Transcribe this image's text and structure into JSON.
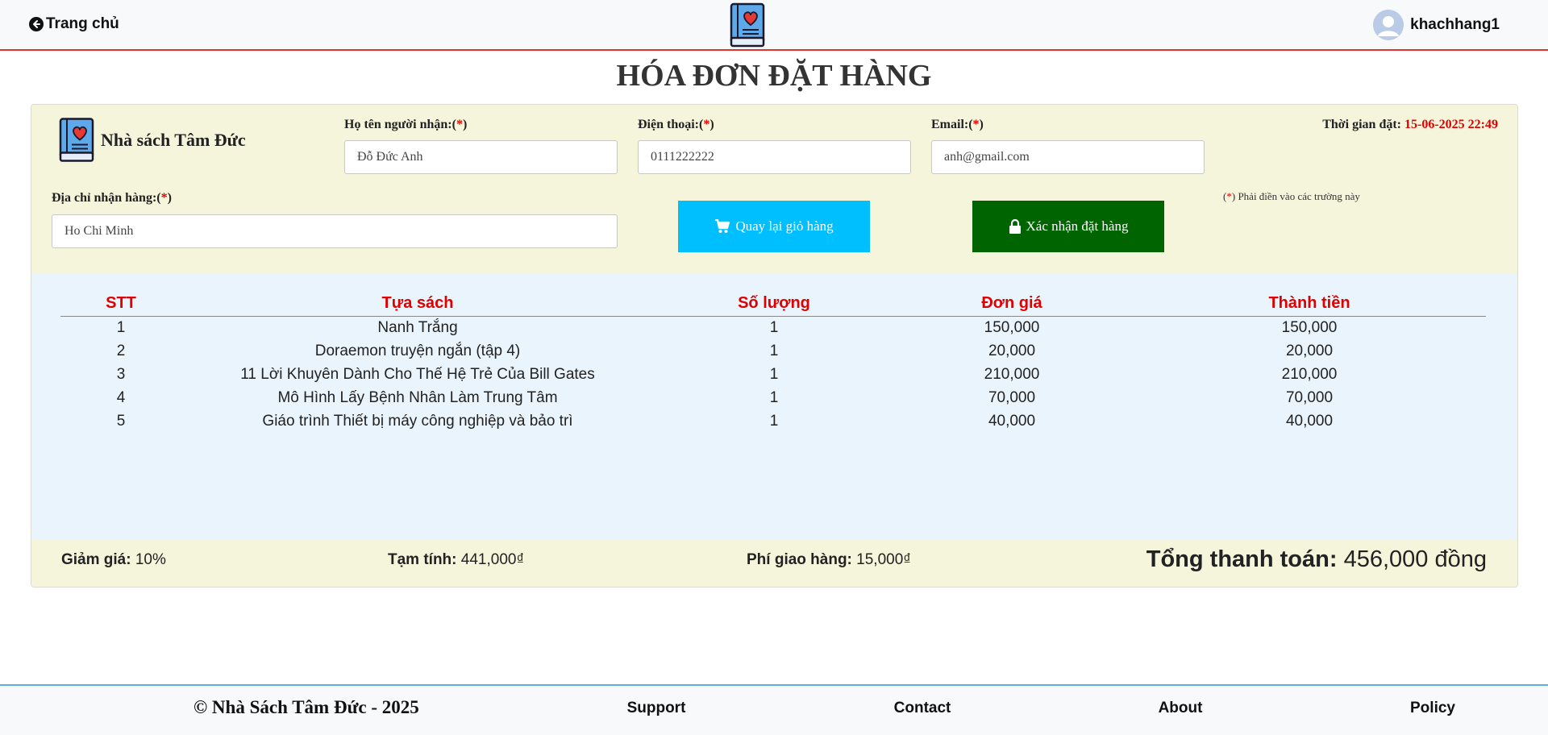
{
  "header": {
    "home_label": "Trang chủ",
    "username": "khachhang1",
    "logo_icon": "book-heart-icon"
  },
  "page_title": "HÓA ĐƠN ĐẶT HÀNG",
  "shop": {
    "name": "Nhà sách Tâm Đức"
  },
  "form": {
    "required_mark": "*",
    "name_label": "Họ tên người nhận:",
    "name_value": "Đỗ Đức Anh",
    "phone_label": "Điện thoại:",
    "phone_value": "0111222222",
    "email_label": "Email:",
    "email_value": "anh@gmail.com",
    "address_label": "Địa chỉ nhận hàng:",
    "address_value": "Ho Chi Minh",
    "order_time_label": "Thời gian đặt:",
    "order_time_value": "15-06-2025 22:49",
    "note_text": "Phải điền vào các trường này"
  },
  "buttons": {
    "back_label": "Quay lại giỏ hàng",
    "confirm_label": "Xác nhận đặt hàng"
  },
  "table": {
    "headers": [
      "STT",
      "Tựa sách",
      "Số lượng",
      "Đơn giá",
      "Thành tiền"
    ],
    "rows": [
      [
        "1",
        "Nanh Trắng",
        "1",
        "150,000",
        "150,000"
      ],
      [
        "2",
        "Doraemon truyện ngắn (tập 4)",
        "1",
        "20,000",
        "20,000"
      ],
      [
        "3",
        "11 Lời Khuyên Dành Cho Thế Hệ Trẻ Của Bill Gates",
        "1",
        "210,000",
        "210,000"
      ],
      [
        "4",
        "Mô Hình Lấy Bệnh Nhân Làm Trung Tâm",
        "1",
        "70,000",
        "70,000"
      ],
      [
        "5",
        "Giáo trình Thiết bị máy công nghiệp và bảo trì",
        "1",
        "40,000",
        "40,000"
      ]
    ]
  },
  "summary": {
    "discount_label": "Giảm giá:",
    "discount_value": "10%",
    "subtotal_label": "Tạm tính:",
    "subtotal_value": "441,000₫",
    "shipping_label": "Phí giao hàng:",
    "shipping_value": "15,000₫",
    "total_label": "Tổng thanh toán:",
    "total_value": "456,000 đồng"
  },
  "footer": {
    "copyright": "© Nhà Sách Tâm Đức - 2025",
    "links": [
      "Support",
      "Contact",
      "About",
      "Policy"
    ]
  },
  "colors": {
    "accent_red": "#e00000",
    "back_button": "#00bfff",
    "confirm_button": "#006400",
    "header_border": "#e0332f",
    "footer_border": "#5dade2"
  }
}
